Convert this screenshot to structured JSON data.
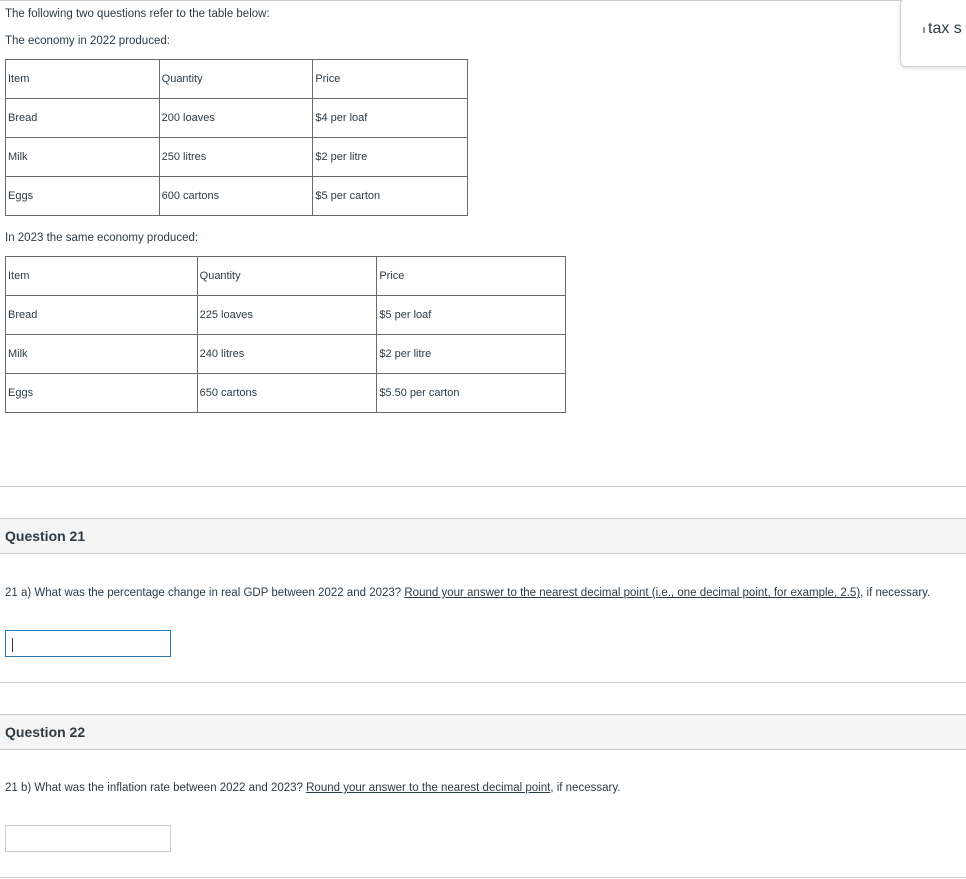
{
  "intro": {
    "line1": "The following two questions refer to the table below:",
    "line2": "The economy in 2022 produced:",
    "line3": "In 2023 the same economy produced:"
  },
  "table2022": {
    "headers": [
      "Item",
      "Quantity",
      "Price"
    ],
    "rows": [
      [
        "Bread",
        "200 loaves",
        "$4 per loaf"
      ],
      [
        "Milk",
        "250 litres",
        "$2 per litre"
      ],
      [
        "Eggs",
        "600 cartons",
        "$5 per carton"
      ]
    ]
  },
  "table2023": {
    "headers": [
      "Item",
      "Quantity",
      "Price"
    ],
    "rows": [
      [
        "Bread",
        "225 loaves",
        "$5 per loaf"
      ],
      [
        "Milk",
        "240 litres",
        "$2 per litre"
      ],
      [
        "Eggs",
        "650 cartons",
        "$5.50 per carton"
      ]
    ]
  },
  "popover": {
    "text": "tax s"
  },
  "q21": {
    "title": "Question 21",
    "prompt_start": "21 a) What was the percentage change in real GDP between 2022 and 2023? ",
    "link_text": "Round your answer to the nearest decimal point (i.e., one decimal point, for example, 2.5)",
    "prompt_end": ", if necessary.",
    "answer_value": ""
  },
  "q22": {
    "title": "Question 22",
    "prompt_start": "21 b) What was the inflation rate between 2022 and 2023? ",
    "link_text": "Round your answer to the nearest decimal point",
    "prompt_end": ", if necessary.",
    "answer_value": ""
  },
  "colors": {
    "text": "#2d3b45",
    "border": "#c7cdd1",
    "header_bg": "#f5f5f5",
    "focus": "#2b7abc"
  }
}
